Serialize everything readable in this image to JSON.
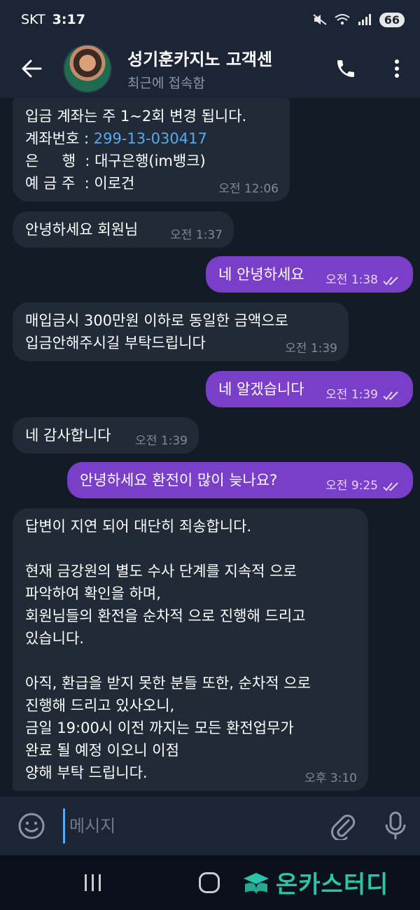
{
  "status_bar": {
    "carrier": "SKT",
    "time": "3:17",
    "battery": "66"
  },
  "header": {
    "title": "성기훈카지노 고객센",
    "subtitle": "최근에 접속함"
  },
  "messages": [
    {
      "direction": "in",
      "lines_before": "입금 계좌는 주 1~2회 변경 됩니다.\n계좌번호 : ",
      "account_number": "299-13-030417",
      "lines_after": "\n은     행  : 대구은행(im뱅크)\n예 금 주  : 이로건",
      "time": "오전 12:06"
    },
    {
      "direction": "in",
      "text": "안녕하세요 회원님",
      "time": "오전 1:37"
    },
    {
      "direction": "out",
      "text": "네 안녕하세요",
      "time": "오전 1:38"
    },
    {
      "direction": "in",
      "text": "매입금시 300만원 이하로 동일한 금액으로\n입금안해주시길 부탁드립니다",
      "time": "오전 1:39"
    },
    {
      "direction": "out",
      "text": "네 알겠습니다",
      "time": "오전 1:39"
    },
    {
      "direction": "in",
      "text": "네 감사합니다",
      "time": "오전 1:39"
    },
    {
      "direction": "out",
      "text": "안녕하세요 환전이 많이 늦나요?",
      "time": "오전 9:25"
    },
    {
      "direction": "in",
      "text": "답변이 지연 되어 대단히 죄송합니다.\n\n현재 금강원의 별도 수사 단계를 지속적 으로\n파악하여 확인을 하며,\n회원님들의 환전을 순차적 으로 진행해 드리고\n있습니다.\n\n아직, 환급을 받지 못한 분들 또한, 순차적 으로\n진행해 드리고 있사오니,\n금일 19:00시 이전 까지는 모든 환전업무가\n완료 될 예정 이오니 이점\n양해 부탁 드립니다.",
      "time": "오후 3:10"
    }
  ],
  "input": {
    "placeholder": "메시지"
  },
  "watermark": {
    "text": "온카스터디"
  },
  "colors": {
    "header_bg": "#1c2535",
    "chat_bg": "#131b26",
    "incoming_bubble": "#212b38",
    "outgoing_bubble": "#7a3fc8",
    "link": "#5aa9f0",
    "watermark": "#2cc4a8"
  }
}
